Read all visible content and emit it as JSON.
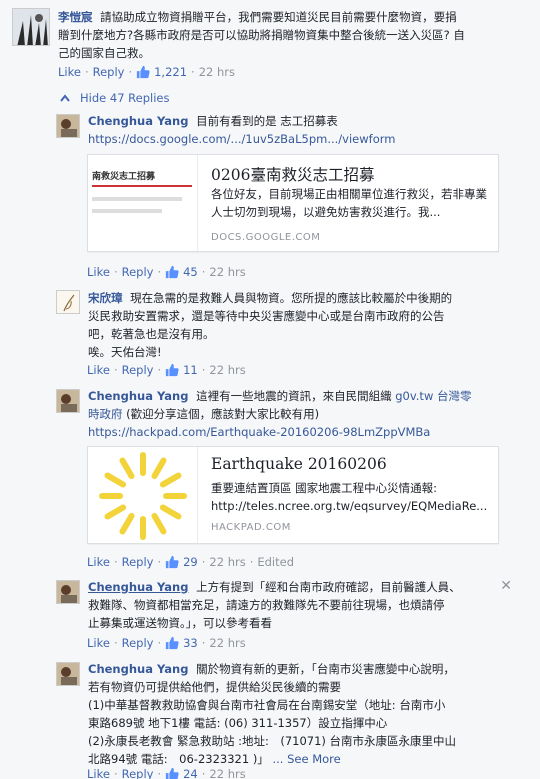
{
  "top_comment": {
    "author": "李愷宸",
    "lines": [
      "請協助成立物資捐贈平台，我們需要知道災民目前需要什麼物資，要捐",
      "贈到什麼地方?各縣市政府是否可以協助將捐贈物資集中整合後統一送入災區? 自",
      "己的國家自己救。"
    ],
    "like_label": "Like",
    "reply_label": "Reply",
    "likes": "1,221",
    "time": "22 hrs"
  },
  "hide_replies_label": "Hide 47 Replies",
  "replies": [
    {
      "author": "Chenghua Yang",
      "text": "目前有看到的是 志工招募表",
      "url": "https://docs.google.com/.../1uv5zBaL5pm.../viewform",
      "card": {
        "thumb_text": "南救災志工招募",
        "title": "0206臺南救災志工招募",
        "desc": "各位好友，目前現場正由相關單位進行救災，若非專業人士切勿到現場，以避免妨害救災進行。我...",
        "domain": "DOCS.GOOGLE.COM"
      },
      "like_label": "Like",
      "reply_label": "Reply",
      "likes": "45",
      "time": "22 hrs"
    },
    {
      "author": "宋欣璋",
      "lines": [
        "現在急需的是救難人員與物資。您所提的應該比較屬於中後期的",
        "災民救助安置需求，還是等待中央災害應變中心或是台南市政府的公告",
        "吧，乾著急也是沒有用。",
        "唉。天佑台灣!"
      ],
      "like_label": "Like",
      "reply_label": "Reply",
      "likes": "11",
      "time": "22 hrs"
    },
    {
      "author": "Chenghua Yang",
      "text_before": "這裡有一些地震的資訊，來自民間組織 ",
      "tag1": "g0v.tw",
      "tag2": "台灣零",
      "tag2b": "時政府",
      "text_after": " (歡迎分享這個，應該對大家比較有用)",
      "url": "https://hackpad.com/Earthquake-20160206-98LmZppVMBa",
      "card": {
        "title": "Earthquake 20160206",
        "desc1": "重要連結置頂區 國家地震工程中心災情通報:",
        "desc2": "http://teles.ncree.org.tw/eqsurvey/EQMediaRe...",
        "domain": "HACKPAD.COM"
      },
      "like_label": "Like",
      "reply_label": "Reply",
      "likes": "29",
      "time": "22 hrs",
      "edited": "Edited"
    },
    {
      "author": "Chenghua Yang",
      "lines": [
        "上方有提到「經和台南市政府確認，目前醫護人員、",
        "救難隊、物資都相當充足，請遠方的救難隊先不要前往現場，也煩請停",
        "止募集或運送物資。」，可以參考看看"
      ],
      "close": "✕",
      "like_label": "Like",
      "reply_label": "Reply",
      "likes": "33",
      "time": "22 hrs"
    },
    {
      "author": "Chenghua Yang",
      "lines": [
        "關於物資有新的更新，「台南市災害應變中心說明，",
        "若有物資仍可提供給他們，提供給災民後續的需要",
        "(1)中華基督教救助協會與台南市社會局在台南錫安堂（地址: 台南市小",
        "東路689號 地下1樓 電話: (06) 311-1357）設立指揮中心",
        "(2)永康長老教會 緊急救助站 :地址:　(71071) 台南市永康區永康里中山"
      ],
      "last_line": "北路94號 電話:　06-2323321 )」",
      "see_more": "... See More",
      "like_label": "Like",
      "reply_label": "Reply",
      "likes": "24",
      "time": "22 hrs"
    }
  ]
}
